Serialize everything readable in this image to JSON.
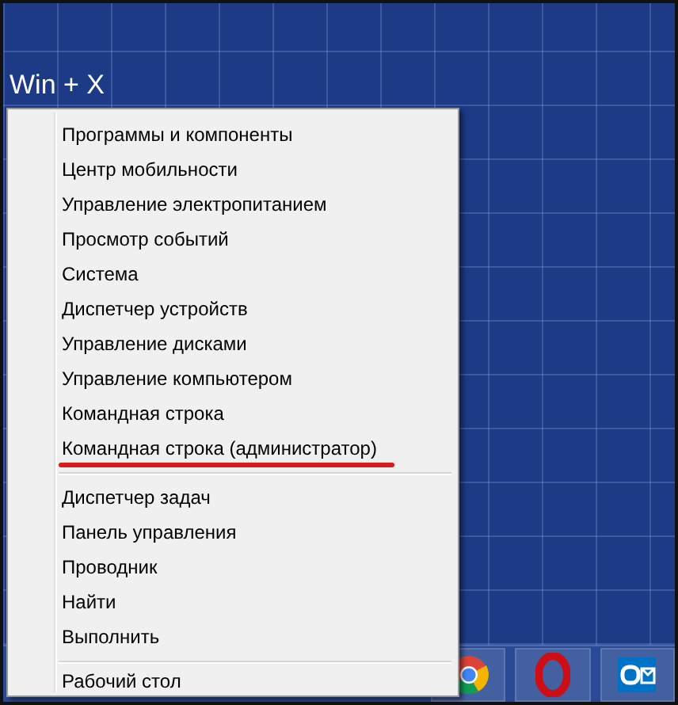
{
  "hotkey": "Win + X",
  "menu": {
    "groups": [
      [
        {
          "label": "Программы и компоненты",
          "highlighted": false
        },
        {
          "label": "Центр мобильности",
          "highlighted": false
        },
        {
          "label": "Управление электропитанием",
          "highlighted": false
        },
        {
          "label": "Просмотр событий",
          "highlighted": false
        },
        {
          "label": "Система",
          "highlighted": false
        },
        {
          "label": "Диспетчер устройств",
          "highlighted": false
        },
        {
          "label": "Управление дисками",
          "highlighted": false
        },
        {
          "label": "Управление компьютером",
          "highlighted": false
        },
        {
          "label": "Командная строка",
          "highlighted": false
        },
        {
          "label": "Командная строка (администратор)",
          "highlighted": true
        }
      ],
      [
        {
          "label": "Диспетчер задач",
          "highlighted": false
        },
        {
          "label": "Панель управления",
          "highlighted": false
        },
        {
          "label": "Проводник",
          "highlighted": false
        },
        {
          "label": "Найти",
          "highlighted": false
        },
        {
          "label": "Выполнить",
          "highlighted": false
        }
      ],
      [
        {
          "label": "Рабочий стол",
          "highlighted": false
        }
      ]
    ]
  }
}
